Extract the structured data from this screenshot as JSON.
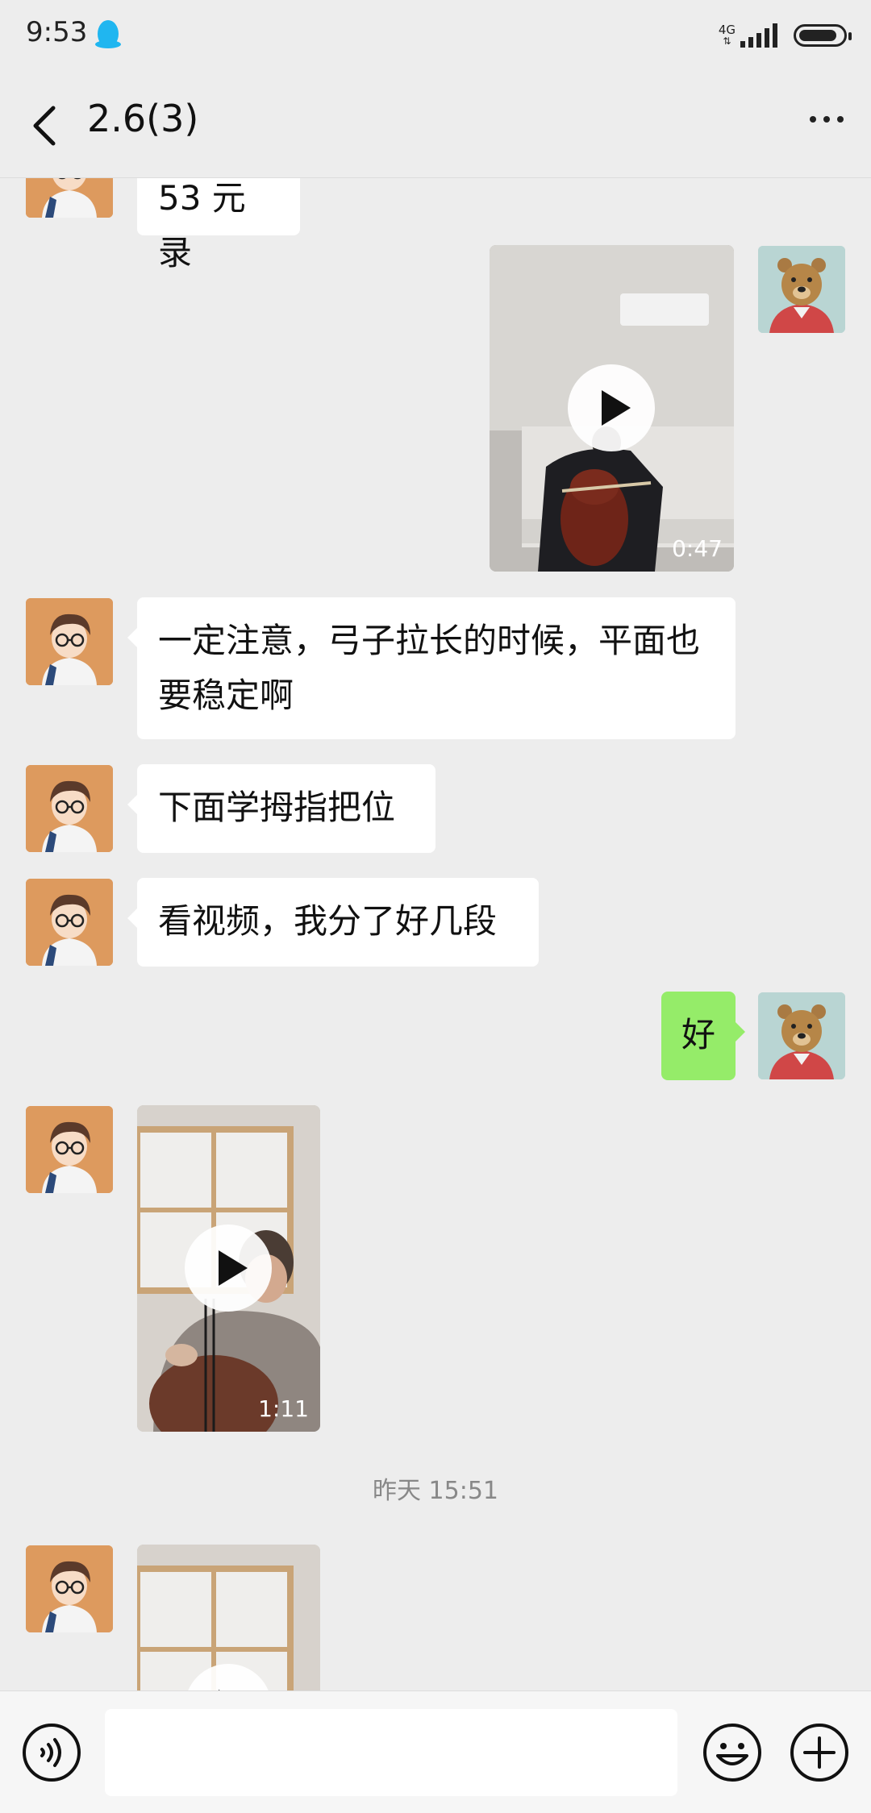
{
  "status_bar": {
    "time": "9:53",
    "network": "4G"
  },
  "header": {
    "title": "2.6(3)"
  },
  "messages": {
    "m0": {
      "text": "53 元录"
    },
    "m1": {
      "duration": "0:47"
    },
    "m2": {
      "text": "一定注意，弓子拉长的时候，平面也要稳定啊"
    },
    "m3": {
      "text": "下面学拇指把位"
    },
    "m4": {
      "text": "看视频，我分了好几段"
    },
    "m5": {
      "text": "好"
    },
    "m6": {
      "duration": "1:11"
    },
    "m8": {
      "duration": ""
    }
  },
  "timestamp": "昨天 15:51",
  "input": {
    "placeholder": ""
  },
  "colors": {
    "background": "#ededed",
    "sent_bubble": "#95ec69",
    "received_bubble": "#ffffff"
  }
}
